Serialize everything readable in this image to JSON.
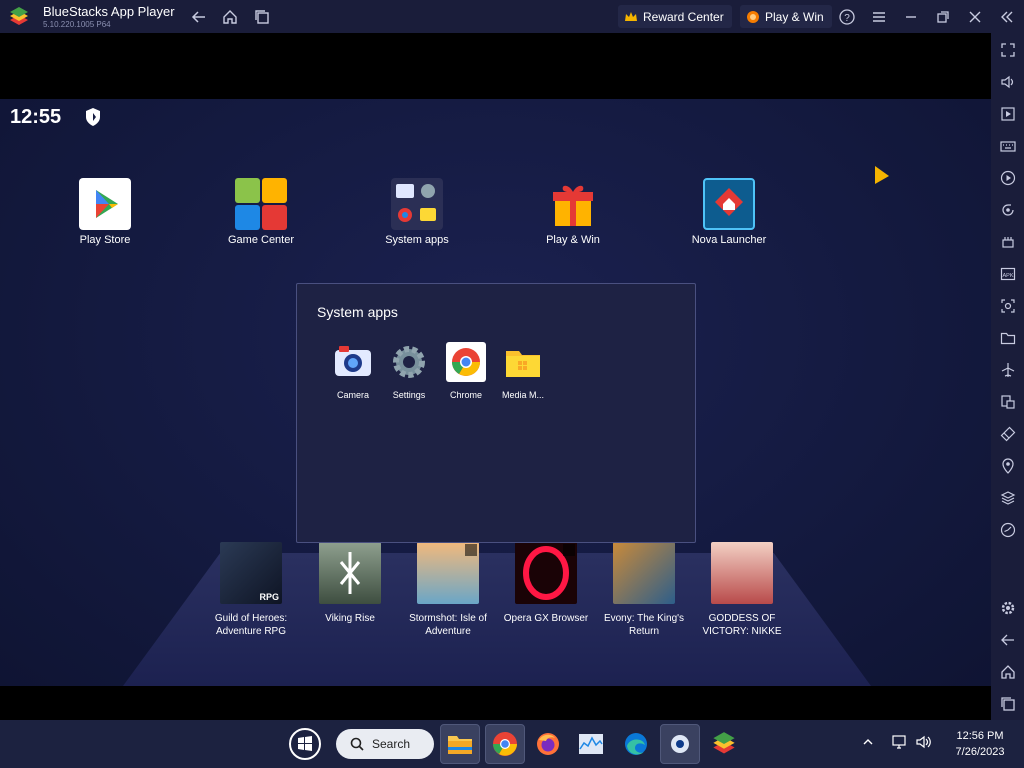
{
  "window": {
    "title": "BlueStacks App Player",
    "version": "5.10.220.1005 P64",
    "reward_center": "Reward Center",
    "play_win": "Play & Win"
  },
  "android": {
    "clock": "12:55",
    "home_apps": [
      {
        "label": "Play Store",
        "icon": "play-store-icon"
      },
      {
        "label": "Game Center",
        "icon": "game-center-icon"
      },
      {
        "label": "System apps",
        "icon": "system-apps-folder-icon"
      },
      {
        "label": "Play & Win",
        "icon": "gift-icon"
      },
      {
        "label": "Nova Launcher",
        "icon": "nova-launcher-icon"
      }
    ],
    "folder": {
      "title": "System apps",
      "apps": [
        {
          "label": "Camera",
          "icon": "camera-icon"
        },
        {
          "label": "Settings",
          "icon": "settings-gear-icon"
        },
        {
          "label": "Chrome",
          "icon": "chrome-icon"
        },
        {
          "label": "Media M...",
          "icon": "media-manager-icon"
        }
      ]
    },
    "games": [
      {
        "line1": "Guild of Heroes:",
        "line2": "Adventure RPG",
        "badge": "RPG"
      },
      {
        "line1": "Viking Rise",
        "line2": ""
      },
      {
        "line1": "Stormshot: Isle of",
        "line2": "Adventure"
      },
      {
        "line1": "Opera GX Browser",
        "line2": ""
      },
      {
        "line1": "Evony: The King's",
        "line2": "Return"
      },
      {
        "line1": "GODDESS OF",
        "line2": "VICTORY: NIKKE"
      }
    ]
  },
  "taskbar": {
    "search": "Search",
    "time": "12:56 PM",
    "date": "7/26/2023"
  },
  "colors": {
    "titlebar": "#1a1d3a",
    "android_bg": "#141a40",
    "taskbar": "#1c2240"
  }
}
